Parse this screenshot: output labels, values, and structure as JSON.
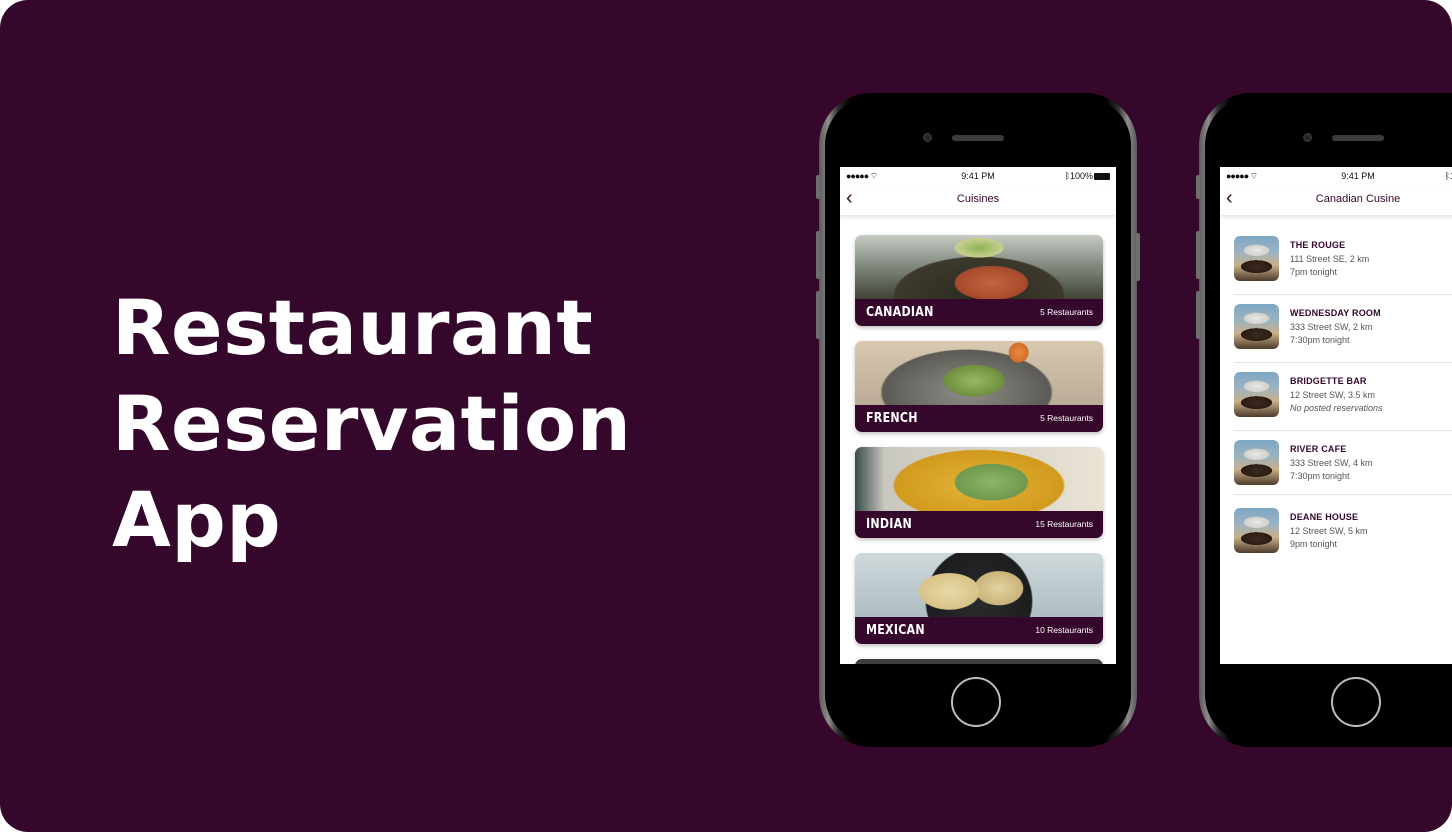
{
  "hero": {
    "line1": "Restaurant",
    "line2": "Reservation",
    "line3": "App"
  },
  "status_bar": {
    "signal": "●●●●● ",
    "time": "9:41 PM",
    "battery": "100%"
  },
  "screen_cuisines": {
    "back_icon": "chevron-left-icon",
    "title": "Cuisines",
    "cards": [
      {
        "name": "CANADIAN",
        "count": "5 Restaurants"
      },
      {
        "name": "FRENCH",
        "count": "5 Restaurants"
      },
      {
        "name": "INDIAN",
        "count": "15 Restaurants"
      },
      {
        "name": "MEXICAN",
        "count": "10 Restaurants"
      }
    ]
  },
  "screen_restaurants": {
    "back_icon": "chevron-left-icon",
    "title": "Canadian Cusine",
    "items": [
      {
        "name": "THE ROUGE",
        "address": "111 Street SE, 2 km",
        "time": "7pm tonight"
      },
      {
        "name": "WEDNESDAY ROOM",
        "address": "333 Street SW, 2 km",
        "time": "7:30pm tonight"
      },
      {
        "name": "BRIDGETTE BAR",
        "address": "12 Street SW, 3.5 km",
        "time": "No posted reservations"
      },
      {
        "name": "RIVER CAFE",
        "address": "333 Street SW, 4 km",
        "time": "7:30pm tonight"
      },
      {
        "name": "DEANE HOUSE",
        "address": "12 Street SW, 5 km",
        "time": "9pm tonight"
      }
    ]
  },
  "colors": {
    "brand": "#34072b",
    "text_secondary": "#555555"
  }
}
